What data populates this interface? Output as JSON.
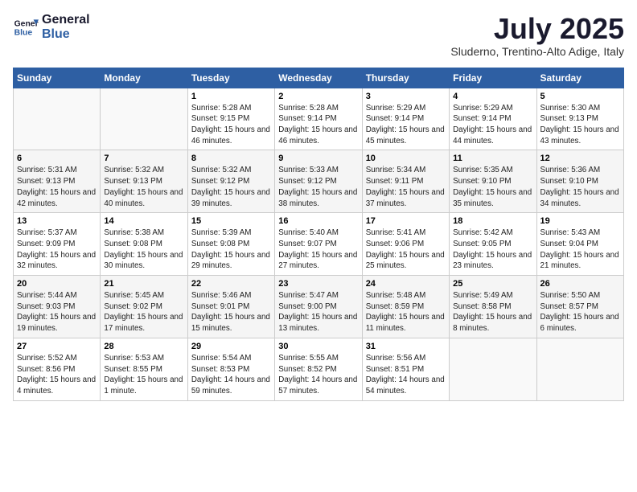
{
  "header": {
    "logo_line1": "General",
    "logo_line2": "Blue",
    "month": "July 2025",
    "location": "Sluderno, Trentino-Alto Adige, Italy"
  },
  "columns": [
    "Sunday",
    "Monday",
    "Tuesday",
    "Wednesday",
    "Thursday",
    "Friday",
    "Saturday"
  ],
  "weeks": [
    [
      {
        "day": "",
        "detail": ""
      },
      {
        "day": "",
        "detail": ""
      },
      {
        "day": "1",
        "detail": "Sunrise: 5:28 AM\nSunset: 9:15 PM\nDaylight: 15 hours and 46 minutes."
      },
      {
        "day": "2",
        "detail": "Sunrise: 5:28 AM\nSunset: 9:14 PM\nDaylight: 15 hours and 46 minutes."
      },
      {
        "day": "3",
        "detail": "Sunrise: 5:29 AM\nSunset: 9:14 PM\nDaylight: 15 hours and 45 minutes."
      },
      {
        "day": "4",
        "detail": "Sunrise: 5:29 AM\nSunset: 9:14 PM\nDaylight: 15 hours and 44 minutes."
      },
      {
        "day": "5",
        "detail": "Sunrise: 5:30 AM\nSunset: 9:13 PM\nDaylight: 15 hours and 43 minutes."
      }
    ],
    [
      {
        "day": "6",
        "detail": "Sunrise: 5:31 AM\nSunset: 9:13 PM\nDaylight: 15 hours and 42 minutes."
      },
      {
        "day": "7",
        "detail": "Sunrise: 5:32 AM\nSunset: 9:13 PM\nDaylight: 15 hours and 40 minutes."
      },
      {
        "day": "8",
        "detail": "Sunrise: 5:32 AM\nSunset: 9:12 PM\nDaylight: 15 hours and 39 minutes."
      },
      {
        "day": "9",
        "detail": "Sunrise: 5:33 AM\nSunset: 9:12 PM\nDaylight: 15 hours and 38 minutes."
      },
      {
        "day": "10",
        "detail": "Sunrise: 5:34 AM\nSunset: 9:11 PM\nDaylight: 15 hours and 37 minutes."
      },
      {
        "day": "11",
        "detail": "Sunrise: 5:35 AM\nSunset: 9:10 PM\nDaylight: 15 hours and 35 minutes."
      },
      {
        "day": "12",
        "detail": "Sunrise: 5:36 AM\nSunset: 9:10 PM\nDaylight: 15 hours and 34 minutes."
      }
    ],
    [
      {
        "day": "13",
        "detail": "Sunrise: 5:37 AM\nSunset: 9:09 PM\nDaylight: 15 hours and 32 minutes."
      },
      {
        "day": "14",
        "detail": "Sunrise: 5:38 AM\nSunset: 9:08 PM\nDaylight: 15 hours and 30 minutes."
      },
      {
        "day": "15",
        "detail": "Sunrise: 5:39 AM\nSunset: 9:08 PM\nDaylight: 15 hours and 29 minutes."
      },
      {
        "day": "16",
        "detail": "Sunrise: 5:40 AM\nSunset: 9:07 PM\nDaylight: 15 hours and 27 minutes."
      },
      {
        "day": "17",
        "detail": "Sunrise: 5:41 AM\nSunset: 9:06 PM\nDaylight: 15 hours and 25 minutes."
      },
      {
        "day": "18",
        "detail": "Sunrise: 5:42 AM\nSunset: 9:05 PM\nDaylight: 15 hours and 23 minutes."
      },
      {
        "day": "19",
        "detail": "Sunrise: 5:43 AM\nSunset: 9:04 PM\nDaylight: 15 hours and 21 minutes."
      }
    ],
    [
      {
        "day": "20",
        "detail": "Sunrise: 5:44 AM\nSunset: 9:03 PM\nDaylight: 15 hours and 19 minutes."
      },
      {
        "day": "21",
        "detail": "Sunrise: 5:45 AM\nSunset: 9:02 PM\nDaylight: 15 hours and 17 minutes."
      },
      {
        "day": "22",
        "detail": "Sunrise: 5:46 AM\nSunset: 9:01 PM\nDaylight: 15 hours and 15 minutes."
      },
      {
        "day": "23",
        "detail": "Sunrise: 5:47 AM\nSunset: 9:00 PM\nDaylight: 15 hours and 13 minutes."
      },
      {
        "day": "24",
        "detail": "Sunrise: 5:48 AM\nSunset: 8:59 PM\nDaylight: 15 hours and 11 minutes."
      },
      {
        "day": "25",
        "detail": "Sunrise: 5:49 AM\nSunset: 8:58 PM\nDaylight: 15 hours and 8 minutes."
      },
      {
        "day": "26",
        "detail": "Sunrise: 5:50 AM\nSunset: 8:57 PM\nDaylight: 15 hours and 6 minutes."
      }
    ],
    [
      {
        "day": "27",
        "detail": "Sunrise: 5:52 AM\nSunset: 8:56 PM\nDaylight: 15 hours and 4 minutes."
      },
      {
        "day": "28",
        "detail": "Sunrise: 5:53 AM\nSunset: 8:55 PM\nDaylight: 15 hours and 1 minute."
      },
      {
        "day": "29",
        "detail": "Sunrise: 5:54 AM\nSunset: 8:53 PM\nDaylight: 14 hours and 59 minutes."
      },
      {
        "day": "30",
        "detail": "Sunrise: 5:55 AM\nSunset: 8:52 PM\nDaylight: 14 hours and 57 minutes."
      },
      {
        "day": "31",
        "detail": "Sunrise: 5:56 AM\nSunset: 8:51 PM\nDaylight: 14 hours and 54 minutes."
      },
      {
        "day": "",
        "detail": ""
      },
      {
        "day": "",
        "detail": ""
      }
    ]
  ]
}
